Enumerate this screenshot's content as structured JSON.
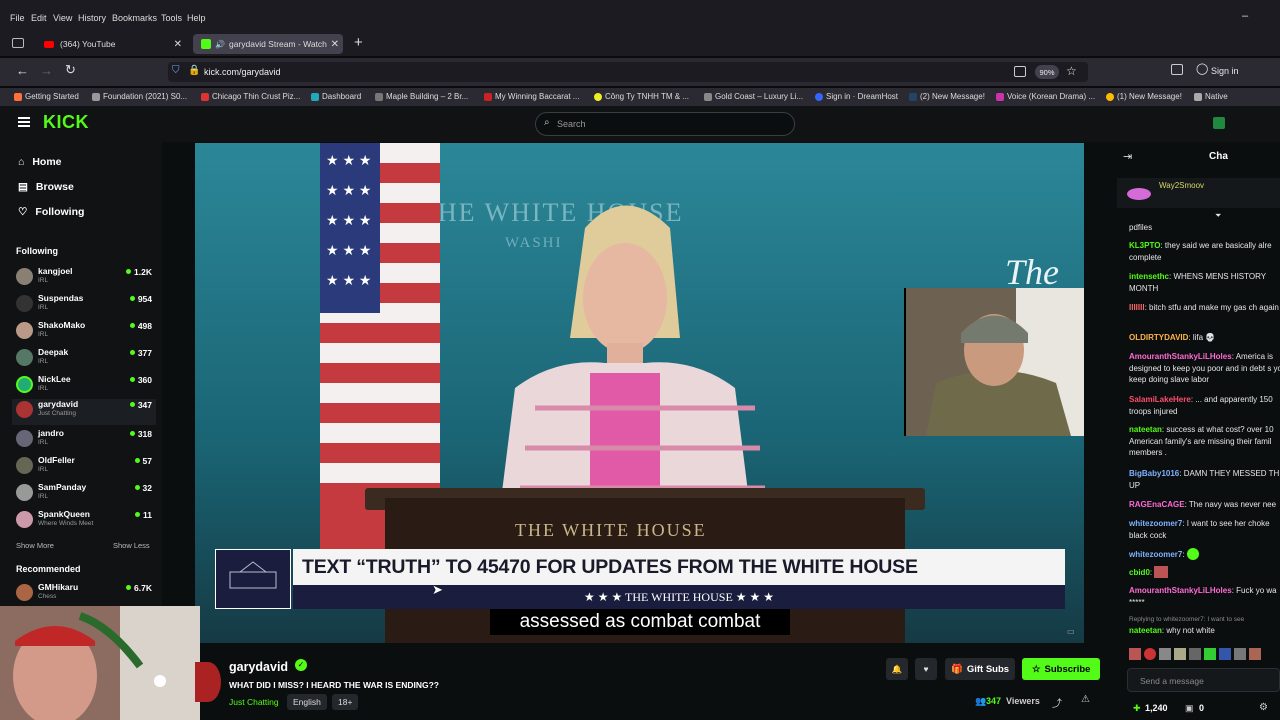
{
  "browser": {
    "menu": [
      "File",
      "Edit",
      "View",
      "History",
      "Bookmarks",
      "Tools",
      "Help"
    ],
    "tabs": [
      {
        "title": "(364) YouTube"
      },
      {
        "title": "garydavid Stream - Watch L"
      }
    ],
    "url": "kick.com/garydavid",
    "zoom": "90%",
    "signin": "Sign in",
    "bookmarks": [
      "Getting Started",
      "Foundation (2021) S0...",
      "Chicago Thin Crust Piz...",
      "Dashboard",
      "Maple Building – 2 Br...",
      "My Winning Baccarat ...",
      "Công Ty TNHH TM & ...",
      "Gold Coast – Luxury Li...",
      "Sign in · DreamHost",
      "(2) New Message!",
      "Voice (Korean Drama) ...",
      "(1) New Message!",
      "Native"
    ]
  },
  "kick": {
    "logo": "KICK",
    "search_placeholder": "Search",
    "nav": [
      {
        "label": "Home",
        "icon": "home-icon"
      },
      {
        "label": "Browse",
        "icon": "compass-icon"
      },
      {
        "label": "Following",
        "icon": "heart-icon"
      }
    ],
    "following_title": "Following",
    "following": [
      {
        "name": "kangjoel",
        "cat": "IRL",
        "viewers": "1.2K"
      },
      {
        "name": "Suspendas",
        "cat": "IRL",
        "viewers": "954"
      },
      {
        "name": "ShakoMako",
        "cat": "IRL",
        "viewers": "498"
      },
      {
        "name": "Deepak",
        "cat": "IRL",
        "viewers": "377"
      },
      {
        "name": "NickLee",
        "cat": "IRL",
        "viewers": "360"
      },
      {
        "name": "garydavid",
        "cat": "Just Chatting",
        "viewers": "347"
      },
      {
        "name": "jandro",
        "cat": "IRL",
        "viewers": "318"
      },
      {
        "name": "OldFeller",
        "cat": "IRL",
        "viewers": "57"
      },
      {
        "name": "SamPanday",
        "cat": "IRL",
        "viewers": "32"
      },
      {
        "name": "SpankQueen",
        "cat": "Where Winds Meet",
        "viewers": "11"
      }
    ],
    "show_more": "Show More",
    "show_less": "Show Less",
    "recommended_title": "Recommended",
    "recommended": [
      {
        "name": "GMHikaru",
        "cat": "Chess",
        "viewers": "6.7K"
      }
    ]
  },
  "video": {
    "lower_third": "TEXT “TRUTH” TO 45470 FOR UPDATES FROM THE WHITE HOUSE",
    "lower_band": "★ ★ ★   THE WHITE HOUSE   ★ ★ ★",
    "backdrop_text": "THE WHITE HOUSE",
    "backdrop_sub": "WASHI",
    "side_text": "The W",
    "podium_text": "THE WHITE HOUSE",
    "caption": "assessed as combat combat"
  },
  "stream": {
    "channel": "garydavid",
    "title": "WHAT DID I MISS? I HEARD THE WAR IS ENDING??",
    "category": "Just Chatting",
    "language": "English",
    "rating": "18+",
    "gift_subs": "Gift Subs",
    "subscribe": "Subscribe",
    "viewers": "347",
    "viewers_label": "Viewers"
  },
  "chat": {
    "header": "Cha",
    "pinned_user": "Way2Smoov",
    "messages": [
      {
        "user": "",
        "text": "pdfiles",
        "color": "#ffffff"
      },
      {
        "user": "KL3PTO",
        "text": "they said we are basically alre complete",
        "color": "#53fc18"
      },
      {
        "user": "intensethc",
        "text": "WHENS MENS HISTORY MONTH",
        "color": "#53fc18"
      },
      {
        "user": "lllllll",
        "text": "bitch stfu and make my gas ch again",
        "color": "#ff6b6b"
      },
      {
        "user": "OLDIRTYDAVID",
        "text": "lifa 💀",
        "color": "#ffb347"
      },
      {
        "user": "AmouranthStankyLiLHoles",
        "text": "America is designed to keep you poor and in debt s you keep doing slave labor",
        "color": "#ff6bd5"
      },
      {
        "user": "SalamiLakeHere",
        "text": "... and apparently 150 troops injured",
        "color": "#ff4d6d"
      },
      {
        "user": "nateetan",
        "text": "success at what cost? over 10 American family's are missing their famil members .",
        "color": "#53fc18"
      },
      {
        "user": "BigBaby1016",
        "text": "DAMN THEY MESSED TH UP",
        "color": "#7fb2ff"
      },
      {
        "user": "RAGEnaCAGE",
        "text": "The navy was never nee",
        "color": "#ff6bd5"
      },
      {
        "user": "whitezoomer7",
        "text": "I want to see her choke black cock",
        "color": "#7fb2ff"
      },
      {
        "user": "whitezoomer7",
        "text": "",
        "color": "#7fb2ff"
      },
      {
        "user": "cbid0",
        "text": "",
        "color": "#53fc18"
      },
      {
        "user": "AmouranthStankyLiLHoles",
        "text": "Fuck yo wa *****",
        "color": "#ff6bd5"
      },
      {
        "user": "",
        "text": "Replying to whitezoomer7: I want to see",
        "color": "#8a8a8a"
      },
      {
        "user": "nateetan",
        "text": "why not white",
        "color": "#53fc18"
      }
    ],
    "send_placeholder": "Send a message",
    "points": "1,240",
    "zero": "0"
  }
}
